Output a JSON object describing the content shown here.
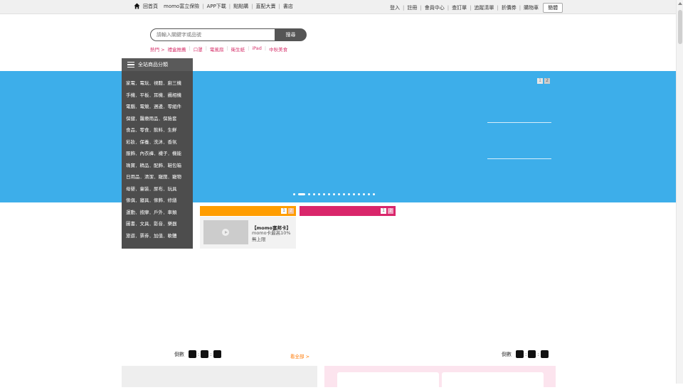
{
  "top_nav": {
    "left": [
      "回首頁",
      "momo富立保險",
      "APP下載",
      "點點購",
      "直配大賣",
      "書店"
    ],
    "right": [
      "登入",
      "註冊",
      "會員中心",
      "查訂單",
      "追蹤清單",
      "折價券",
      "購物車"
    ],
    "lang_button": "簡體"
  },
  "search": {
    "placeholder": "請輸入關鍵字或品號",
    "button_label": "搜尋"
  },
  "hot_words": [
    "熱門 >",
    "禮盒推薦",
    "口罩",
    "電風扇",
    "衛生紙",
    "iPad",
    "中秋美食"
  ],
  "category_menu": {
    "title": "全站商品分類",
    "items": [
      "家電．電玩．視聽．廚三機",
      "手機．平板．耳機．攝相機",
      "電腦．電競．週邊．零組件",
      "保健．醫療用品．保險套",
      "食品．零食．飲料．生鮮",
      "彩妝．保養．洗沐．香氛",
      "服飾．內衣褲．襪子．機能",
      "珠寶．精品．配飾．鞋包箱",
      "日用品．清潔．寵圍．寵物",
      "母嬰．童裝．尿布．玩具",
      "傢俱．寢具．傢飾．修繕",
      "運動．按摩．戶外．車類",
      "圖書．文具．影音．樂器",
      "旅遊．票券．加值．軟體"
    ]
  },
  "banner": {
    "pager": [
      "1",
      "2"
    ],
    "dot_count": 16,
    "active_dot": 1,
    "bg_color": "#3daeea"
  },
  "promo_tabs": {
    "orange": {
      "pager": [
        "1",
        "2"
      ],
      "color": "#ff9d00"
    },
    "pink": {
      "pager": [
        "1",
        "2"
      ],
      "color": "#d9266b"
    }
  },
  "promo_card": {
    "title": "【momo富邦卡】",
    "desc": "momo卡最高10%無上限"
  },
  "countdown": {
    "label": "倒數",
    "see_all": "看全部 >"
  },
  "colors": {
    "hot_word": "#d6336c",
    "category_bg": "#4d4d4d"
  }
}
